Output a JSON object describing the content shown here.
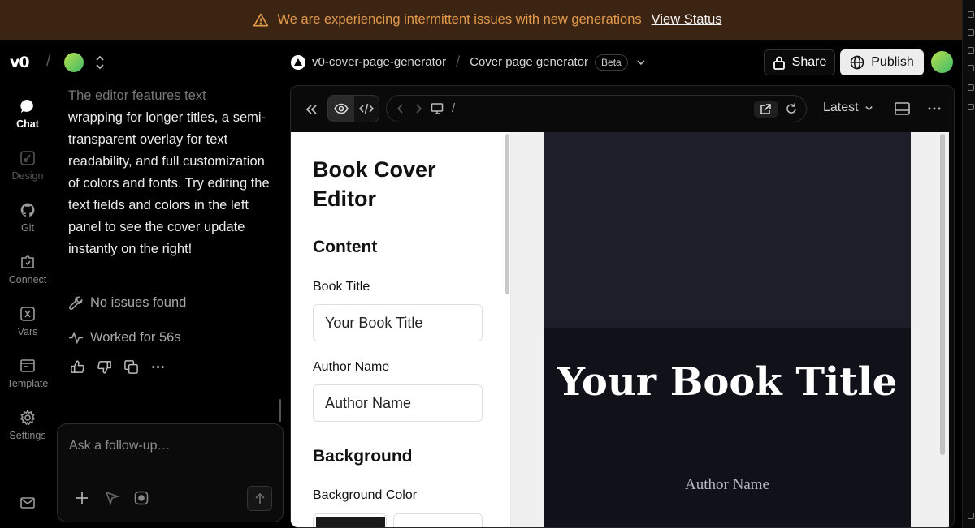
{
  "banner": {
    "message": "We are experiencing intermittent issues with new generations",
    "link": "View Status",
    "icon": "warning-icon"
  },
  "header": {
    "logo": "v0",
    "project_name": "v0-cover-page-generator",
    "chat_title": "Cover page generator",
    "badge": "Beta",
    "share_label": "Share",
    "publish_label": "Publish"
  },
  "rail": {
    "items": [
      {
        "label": "Chat",
        "icon": "chat-icon"
      },
      {
        "label": "Design",
        "icon": "design-icon"
      },
      {
        "label": "Git",
        "icon": "github-icon"
      },
      {
        "label": "Connect",
        "icon": "connect-icon"
      },
      {
        "label": "Vars",
        "icon": "variables-icon"
      },
      {
        "label": "Template",
        "icon": "template-icon"
      },
      {
        "label": "Settings",
        "icon": "gear-icon"
      }
    ]
  },
  "chat": {
    "message_fade": "The editor features text",
    "message": "wrapping for longer titles, a semi-transparent overlay for text readability, and full customization of colors and fonts. Try editing the text fields and colors in the left panel to see the cover update instantly on the right!",
    "status_issues": "No issues found",
    "status_worked": "Worked for 56s",
    "composer_placeholder": "Ask a follow-up…"
  },
  "preview": {
    "url_path": "/",
    "version": "Latest"
  },
  "editor": {
    "heading": "Book Cover Editor",
    "section_content": "Content",
    "book_title_label": "Book Title",
    "book_title_value": "Your Book Title",
    "author_label": "Author Name",
    "author_value": "Author Name",
    "section_background": "Background",
    "bg_color_label": "Background Color"
  },
  "cover": {
    "title": "Your Book Title",
    "author": "Author Name",
    "colors": {
      "background": "#111119",
      "top": "#1d1e29",
      "title": "#ffffff",
      "author": "#b8b8c0"
    }
  },
  "colors": {
    "banner_bg": "#3b2412",
    "banner_text": "#e49a4c",
    "accent_green": "#3fb96a"
  }
}
